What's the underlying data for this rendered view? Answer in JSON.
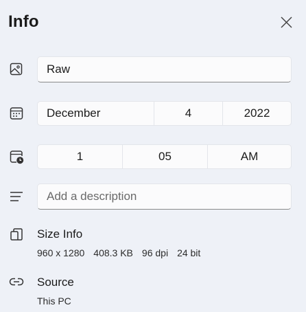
{
  "header": {
    "title": "Info"
  },
  "title_field": {
    "value": "Raw"
  },
  "date": {
    "month": "December",
    "day": "4",
    "year": "2022"
  },
  "time": {
    "hour": "1",
    "minute": "05",
    "period": "AM"
  },
  "description": {
    "placeholder": "Add a description"
  },
  "size_info": {
    "title": "Size Info",
    "dimensions": "960 x 1280",
    "filesize": "408.3 KB",
    "dpi": "96 dpi",
    "bitdepth": "24 bit"
  },
  "source": {
    "title": "Source",
    "value": "This PC"
  },
  "icons": [
    "close-icon",
    "image-icon",
    "calendar-icon",
    "clock-calendar-icon",
    "description-lines-icon",
    "size-info-icon",
    "link-icon"
  ]
}
